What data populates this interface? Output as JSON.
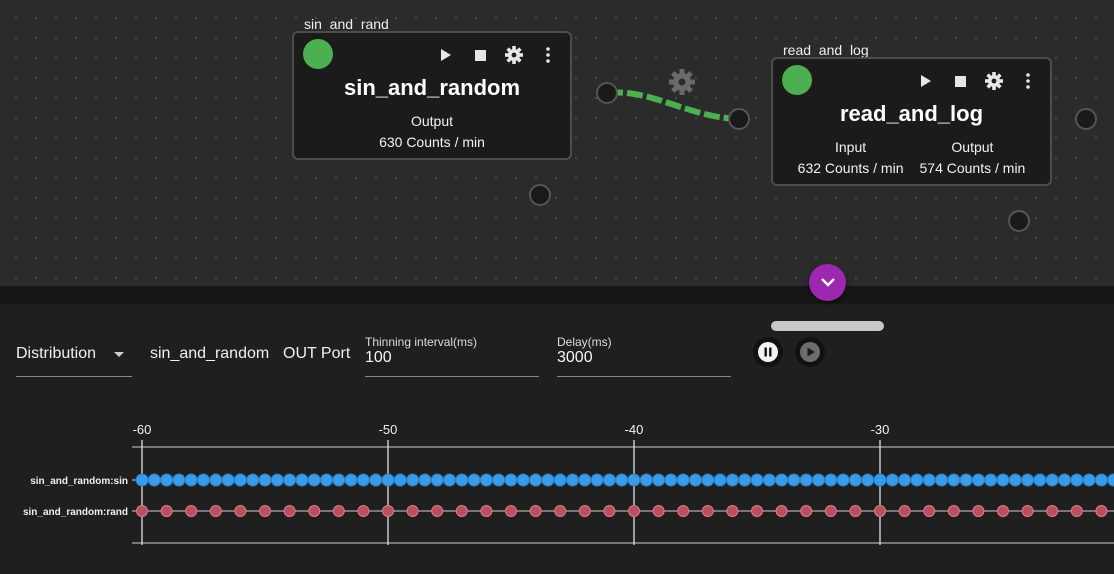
{
  "nodes": [
    {
      "title": "sin_and_rand",
      "name": "sin_and_random",
      "ports": [
        {
          "label": "Output",
          "rate": "630 Counts / min"
        }
      ]
    },
    {
      "title": "read_and_log",
      "name": "read_and_log",
      "ports": [
        {
          "label": "Input",
          "rate": "632 Counts / min"
        },
        {
          "label": "Output",
          "rate": "574 Counts / min"
        }
      ]
    }
  ],
  "icons": {
    "play": "play-icon",
    "stop": "stop-icon",
    "settings": "gear-icon",
    "more": "more-vert-icon",
    "expand": "chevron-down-icon",
    "pause": "pause-icon"
  },
  "colors": {
    "status_running": "#4caf50",
    "edge": "#4caf50",
    "accent": "#9c27b0",
    "series_sin": "#3a9be8",
    "series_rand": "#e05a6e"
  },
  "controls": {
    "view_mode": "Distribution",
    "selected_node": "sin_and_random",
    "port_type": "OUT Port",
    "thinning": {
      "label": "Thinning interval(ms)",
      "value": "100"
    },
    "delay": {
      "label": "Delay(ms)",
      "value": "3000"
    }
  },
  "chart_data": {
    "type": "scatter",
    "x_ticks": [
      -60,
      -50,
      -40,
      -30
    ],
    "xlim": [
      -60.2,
      -20.7
    ],
    "series": [
      {
        "name": "sin_and_random:sin",
        "x_start": -60,
        "x_step": 0.5
      },
      {
        "name": "sin_and_random:rand",
        "x_start": -60,
        "x_step": 1.0
      }
    ]
  }
}
